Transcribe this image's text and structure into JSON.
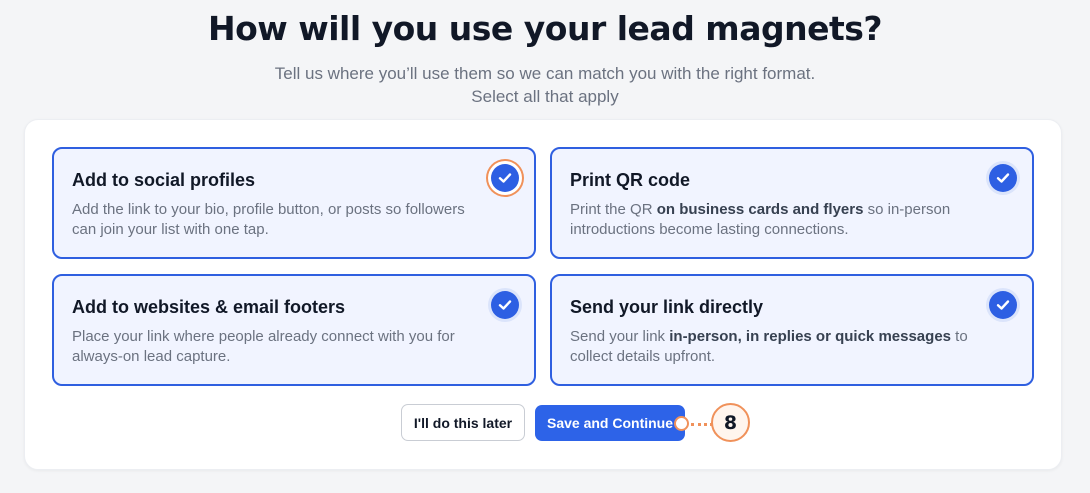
{
  "header": {
    "title": "How will you use your lead magnets?",
    "subtitle_line1": "Tell us where you’ll use them so we can match you with the right format.",
    "subtitle_line2": "Select all that apply"
  },
  "options": [
    {
      "title": "Add to social profiles",
      "desc": "Add the link to your bio, profile button, or posts so followers can join your list with one tap.",
      "checked": true
    },
    {
      "title": "Print QR code",
      "desc_before": "Print the QR ",
      "desc_bold": "on business cards and flyers",
      "desc_after": " so in-person introductions become lasting connections.",
      "checked": true
    },
    {
      "title": "Add to websites & email footers",
      "desc": "Place your link where people already connect with you for always-on lead capture.",
      "checked": true
    },
    {
      "title": "Send your link directly",
      "desc_before": "Send your link ",
      "desc_bold": "in-person, in replies or quick messages",
      "desc_after": " to collect details upfront.",
      "checked": true
    }
  ],
  "actions": {
    "later_label": "I'll do this later",
    "save_label": "Save and Continue"
  },
  "annotation": {
    "step_number": "8"
  },
  "colors": {
    "accent": "#2d63e8",
    "card_bg": "#f1f4ff",
    "annotation": "#f0915a"
  },
  "icons": {
    "check": "checkmark-circle-icon"
  }
}
